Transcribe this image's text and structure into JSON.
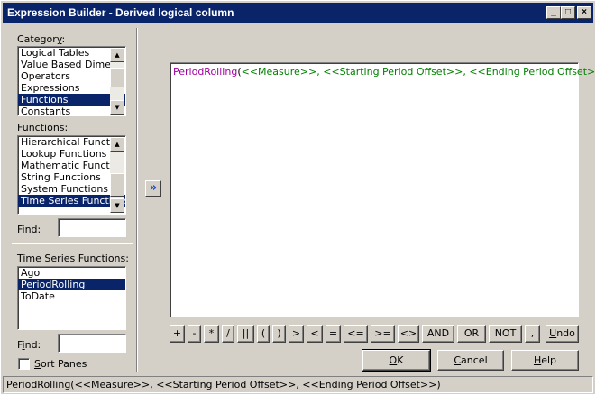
{
  "window": {
    "title": "Expression Builder - Derived logical column",
    "min_glyph": "_",
    "max_glyph": "□",
    "close_glyph": "×"
  },
  "category": {
    "label_pre": "Categor",
    "label_u": "y",
    "label_post": ":",
    "items": [
      "Logical Tables",
      "Value Based Dimensions",
      "Operators",
      "Expressions",
      "Functions",
      "Constants"
    ],
    "selected_index": 4
  },
  "functions": {
    "label": "Functions:",
    "items": [
      "Hierarchical Functions",
      "Lookup Functions",
      "Mathematic Functions",
      "String Functions",
      "System Functions",
      "Time Series Functions"
    ],
    "selected_index": 5
  },
  "find1": {
    "label_u": "F",
    "label_post": "ind:",
    "value": ""
  },
  "series_functions": {
    "label": "Time Series Functions:",
    "items": [
      "Ago",
      "PeriodRolling",
      "ToDate"
    ],
    "selected_index": 1
  },
  "find2": {
    "label_pre": "F",
    "label_u": "i",
    "label_post": "nd:",
    "value": ""
  },
  "sort_panes": {
    "label_u": "S",
    "label_post": "ort Panes",
    "checked": false
  },
  "insert_arrow": "»",
  "expression": {
    "fn": "PeriodRolling",
    "open": "(",
    "arg1": "<<Measure>>",
    "comma1": ", ",
    "arg2": "<<Starting Period Offset>>",
    "comma2": ", ",
    "arg3": "<<Ending Period Offset>>",
    "close": ")"
  },
  "operators": [
    "+",
    "-",
    "*",
    "/",
    "||",
    "(",
    ")",
    ">",
    "<",
    "=",
    "<=",
    ">=",
    "<>",
    "AND",
    "OR",
    "NOT",
    ","
  ],
  "undo": {
    "label_u": "U",
    "label_post": "ndo"
  },
  "buttons": {
    "ok": {
      "label_u": "O",
      "label_post": "K"
    },
    "cancel": {
      "label_u": "C",
      "label_post": "ancel"
    },
    "help": {
      "label_u": "H",
      "label_post": "elp"
    }
  },
  "status_text": "PeriodRolling(<<Measure>>, <<Starting Period Offset>>, <<Ending Period Offset>>)",
  "colors": {
    "titlebar": "#0a246a",
    "selection": "#0a246a",
    "face": "#d4d0c8",
    "function_name": "#a000a0",
    "argument": "#008000"
  }
}
